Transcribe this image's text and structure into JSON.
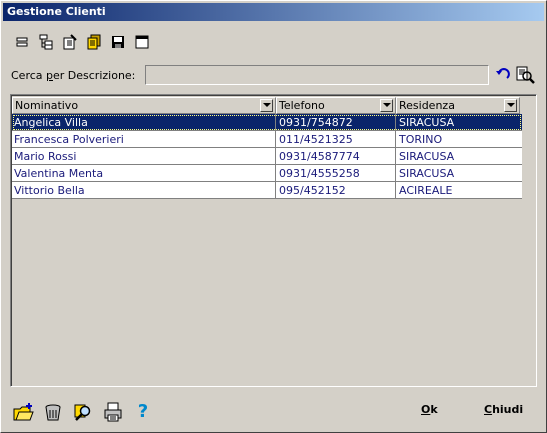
{
  "window": {
    "title": "Gestione Clienti"
  },
  "toolbar": {
    "icons": [
      "list-view-icon",
      "tree-view-icon",
      "edit-icon",
      "copy-icon",
      "save-icon",
      "window-icon"
    ]
  },
  "search": {
    "label_prefix": "Cerca ",
    "label_accel": "p",
    "label_suffix": "er Descrizione:",
    "value": "",
    "placeholder": ""
  },
  "grid": {
    "columns": [
      "Nominativo",
      "Telefono",
      "Residenza"
    ],
    "rows": [
      {
        "nominativo": "Angelica Villa",
        "telefono": "0931/754872",
        "residenza": "SIRACUSA",
        "selected": true
      },
      {
        "nominativo": "Francesca Polverieri",
        "telefono": "011/4521325",
        "residenza": "TORINO",
        "selected": false
      },
      {
        "nominativo": "Mario Rossi",
        "telefono": "0931/4587774",
        "residenza": "SIRACUSA",
        "selected": false
      },
      {
        "nominativo": "Valentina Menta",
        "telefono": "0931/4555258",
        "residenza": "SIRACUSA",
        "selected": false
      },
      {
        "nominativo": "Vittorio Bella",
        "telefono": "095/452152",
        "residenza": "ACIREALE",
        "selected": false
      }
    ]
  },
  "bottom": {
    "ok_accel": "O",
    "ok_rest": "k",
    "close_accel": "C",
    "close_rest": "hiudi",
    "help_glyph": "?"
  },
  "colors": {
    "title_start": "#0a246a",
    "title_end": "#a6caf0",
    "selection": "#0a246a",
    "row_text": "#1a1a7a"
  }
}
